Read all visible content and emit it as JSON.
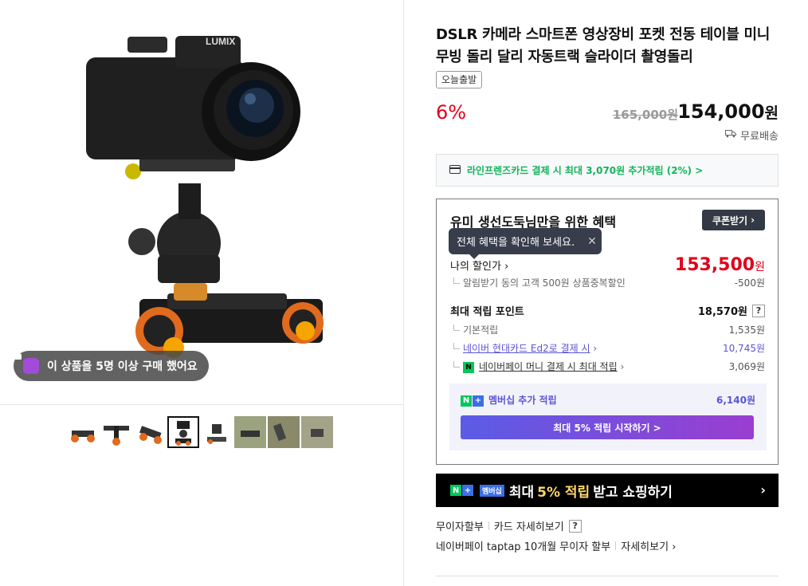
{
  "gallery": {
    "product_alt": "LUMIX camera on motorized slider dolly",
    "camera_brand": "LUMIX",
    "buyers_text": "이 상품을 5명 이상 구매 했어요",
    "thumbnails": [
      {
        "id": 1,
        "active": false
      },
      {
        "id": 2,
        "active": false
      },
      {
        "id": 3,
        "active": false
      },
      {
        "id": 4,
        "active": true
      },
      {
        "id": 5,
        "active": false
      },
      {
        "id": 6,
        "active": false
      },
      {
        "id": 7,
        "active": false
      },
      {
        "id": 8,
        "active": false
      }
    ]
  },
  "product": {
    "title": "DSLR 카메라 스마트폰 영상장비 포켓 전동 테이블 미니 무빙 돌리 달리 자동트랙 슬라이더 촬영돌리",
    "tag": "오늘출발",
    "discount": "6%",
    "original_price": "165,000원",
    "sale_price": "154,000",
    "currency": "원",
    "shipping": "무료배송"
  },
  "card_banner": {
    "text": "라인프렌즈카드 결제 시 최대 3,070원 추가적립 (2%) >"
  },
  "benefits": {
    "title": "유미 생선도둑님만을 위한 혜택",
    "coupon_button": "쿠폰받기",
    "tooltip": "전체 혜택을 확인해 보세요.",
    "my_price_label": "나의 할인가",
    "my_price": "153,500",
    "my_price_unit": "원",
    "alarm_label": "알림받기 동의 고객 500원 상품중복할인",
    "alarm_value": "-500원",
    "max_points_label": "최대 적립 포인트",
    "max_points_value": "18,570원",
    "basic_label": "기본적립",
    "basic_value": "1,535원",
    "hyundai_label": "네이버 현대카드 Ed2로 결제 시",
    "hyundai_value": "10,745원",
    "npay_label": "네이버페이 머니 결제 시 최대 적립",
    "npay_value": "3,069원",
    "member_label": "멤버십 추가 적립",
    "member_value": "6,140원",
    "member_button": "최대 5% 적립 시작하기 >"
  },
  "black_banner": {
    "membership_tag": "멤버십",
    "pre": "최대",
    "highlight": "5% 적립",
    "post": "받고 쇼핑하기"
  },
  "footer_links": {
    "installment": "무이자할부",
    "card_detail": "카드 자세히보기",
    "npay_installment": "네이버페이 taptap 10개월 무이자 할부",
    "detail": "자세히보기"
  },
  "colors": {
    "discount_red": "#e0001a",
    "card_green": "#14b45a",
    "member_purple": "#5b54d4",
    "naver_green": "#03c75a"
  }
}
